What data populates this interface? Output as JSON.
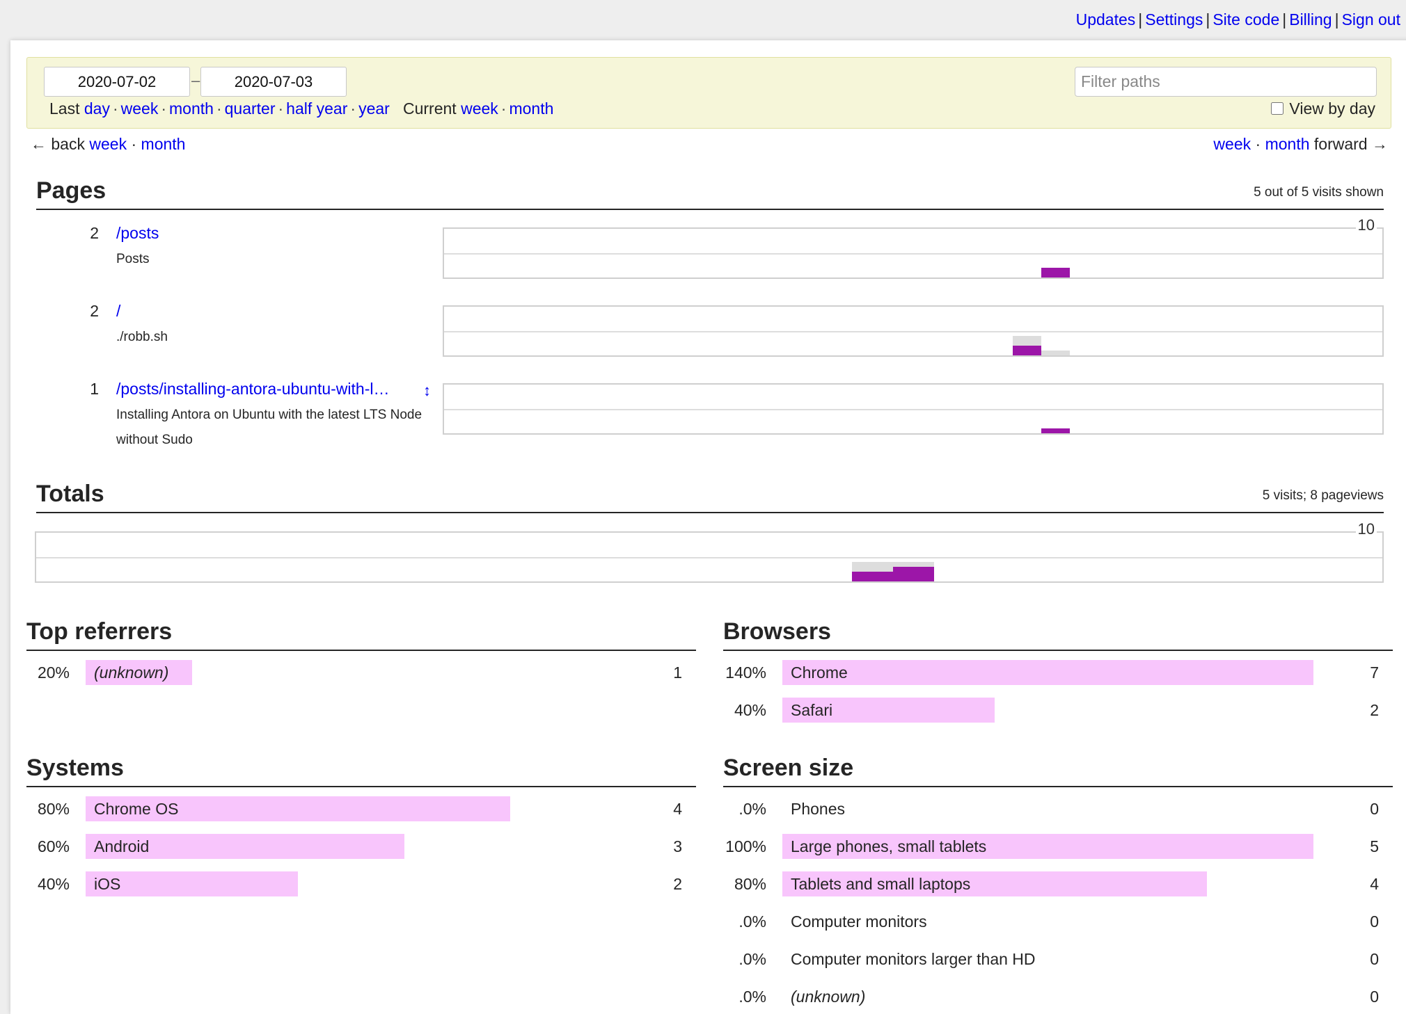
{
  "topnav": {
    "links": [
      "Updates",
      "Settings",
      "Site code",
      "Billing",
      "Sign out"
    ],
    "separator": "|"
  },
  "filter": {
    "start_date": "2020-07-02",
    "end_date": "2020-07-03",
    "dash": "–",
    "last_label": "Last",
    "last_periods": [
      "day",
      "week",
      "month",
      "quarter",
      "half year",
      "year"
    ],
    "current_label": "Current",
    "current_periods": [
      "week",
      "month"
    ],
    "filter_placeholder": "Filter paths",
    "filter_value": "",
    "view_by_day_label": "View by day",
    "view_by_day_checked": false
  },
  "nav": {
    "back_arrow": "←",
    "back_label": "back",
    "back_links": [
      "week",
      "month"
    ],
    "forward_links": [
      "week",
      "month"
    ],
    "forward_label": "forward",
    "forward_arrow": "→"
  },
  "pages": {
    "title": "Pages",
    "meta": "5 out of 5 visits shown",
    "chart_max_label": "10",
    "rows": [
      {
        "count": "2",
        "path": "/posts",
        "title": "Posts",
        "resizable": false
      },
      {
        "count": "2",
        "path": "/",
        "title": "./robb.sh",
        "resizable": false
      },
      {
        "count": "1",
        "path": "/posts/installing-antora-ubuntu-with-l…",
        "title": "Installing Antora on Ubuntu with the latest LTS Node without Sudo",
        "resizable": true,
        "resize_icon": "↕"
      }
    ]
  },
  "totals": {
    "title": "Totals",
    "meta": "5 visits; 8 pageviews",
    "chart_max_label": "10"
  },
  "chart_data": [
    {
      "type": "bar",
      "title": "/posts",
      "ylim": [
        0,
        10
      ],
      "bucket_count": 33,
      "series": [
        {
          "name": "pageviews",
          "color": "#dddddd",
          "points": [
            {
              "bucket": 21,
              "value": 2
            }
          ]
        },
        {
          "name": "visits",
          "color": "#9c16a8",
          "points": [
            {
              "bucket": 21,
              "value": 2
            }
          ]
        }
      ]
    },
    {
      "type": "bar",
      "title": "/",
      "ylim": [
        0,
        10
      ],
      "bucket_count": 33,
      "series": [
        {
          "name": "pageviews",
          "color": "#dddddd",
          "points": [
            {
              "bucket": 20,
              "value": 4
            },
            {
              "bucket": 21,
              "value": 1
            }
          ]
        },
        {
          "name": "visits",
          "color": "#9c16a8",
          "points": [
            {
              "bucket": 20,
              "value": 2
            }
          ]
        }
      ]
    },
    {
      "type": "bar",
      "title": "/posts/installing-antora-ubuntu-with-l…",
      "ylim": [
        0,
        10
      ],
      "bucket_count": 33,
      "series": [
        {
          "name": "pageviews",
          "color": "#dddddd",
          "points": [
            {
              "bucket": 21,
              "value": 1
            }
          ]
        },
        {
          "name": "visits",
          "color": "#9c16a8",
          "points": [
            {
              "bucket": 21,
              "value": 1
            }
          ]
        }
      ]
    },
    {
      "type": "bar",
      "title": "Totals",
      "ylim": [
        0,
        10
      ],
      "bucket_count": 33,
      "series": [
        {
          "name": "pageviews",
          "color": "#dddddd",
          "points": [
            {
              "bucket": 20,
              "value": 4
            },
            {
              "bucket": 21,
              "value": 4
            }
          ]
        },
        {
          "name": "visits",
          "color": "#9c16a8",
          "points": [
            {
              "bucket": 20,
              "value": 2
            },
            {
              "bucket": 21,
              "value": 3
            }
          ]
        }
      ]
    }
  ],
  "stats": {
    "bar_color": "#f8c5fc",
    "referrers": {
      "title": "Top referrers",
      "rows": [
        {
          "pct": "20%",
          "fill": 20,
          "label": "(unknown)",
          "italic": true,
          "count": "1"
        }
      ]
    },
    "browsers": {
      "title": "Browsers",
      "rows": [
        {
          "pct": "140%",
          "fill": 100,
          "label": "Chrome",
          "italic": false,
          "count": "7"
        },
        {
          "pct": "40%",
          "fill": 40,
          "label": "Safari",
          "italic": false,
          "count": "2"
        }
      ]
    },
    "systems": {
      "title": "Systems",
      "rows": [
        {
          "pct": "80%",
          "fill": 80,
          "label": "Chrome OS",
          "italic": false,
          "count": "4"
        },
        {
          "pct": "60%",
          "fill": 60,
          "label": "Android",
          "italic": false,
          "count": "3"
        },
        {
          "pct": "40%",
          "fill": 40,
          "label": "iOS",
          "italic": false,
          "count": "2"
        }
      ]
    },
    "screen_size": {
      "title": "Screen size",
      "rows": [
        {
          "pct": ".0%",
          "fill": 0,
          "label": "Phones",
          "italic": false,
          "count": "0"
        },
        {
          "pct": "100%",
          "fill": 100,
          "label": "Large phones, small tablets",
          "italic": false,
          "count": "5"
        },
        {
          "pct": "80%",
          "fill": 80,
          "label": "Tablets and small laptops",
          "italic": false,
          "count": "4"
        },
        {
          "pct": ".0%",
          "fill": 0,
          "label": "Computer monitors",
          "italic": false,
          "count": "0"
        },
        {
          "pct": ".0%",
          "fill": 0,
          "label": "Computer monitors larger than HD",
          "italic": false,
          "count": "0"
        },
        {
          "pct": ".0%",
          "fill": 0,
          "label": "(unknown)",
          "italic": true,
          "count": "0"
        }
      ]
    }
  }
}
